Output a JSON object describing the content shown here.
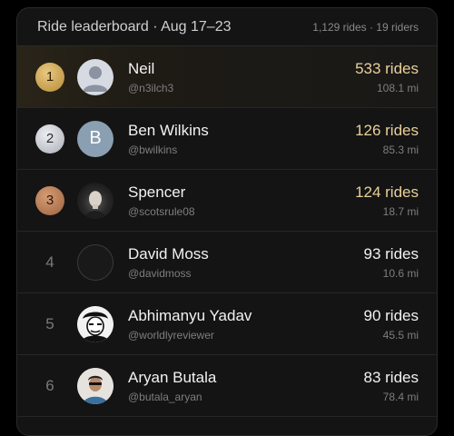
{
  "header": {
    "title": "Ride leaderboard · Aug 17–23",
    "stats": "1,129 rides · 19 riders"
  },
  "colors": {
    "gold": "#e0be72",
    "silver": "#d8dbe0",
    "bronze": "#c08560",
    "highlight_text": "#ead09a"
  },
  "riders": [
    {
      "rank": "1",
      "name": "Neil",
      "handle": "@n3ilch3",
      "rides": "533 rides",
      "miles": "108.1 mi",
      "avatar": "default-avatar-icon"
    },
    {
      "rank": "2",
      "name": "Ben Wilkins",
      "handle": "@bwilkins",
      "rides": "126 rides",
      "miles": "85.3 mi",
      "avatar_letter": "B"
    },
    {
      "rank": "3",
      "name": "Spencer",
      "handle": "@scotsrule08",
      "rides": "124 rides",
      "miles": "18.7 mi",
      "avatar": "photo"
    },
    {
      "rank": "4",
      "name": "David Moss",
      "handle": "@davidmoss",
      "rides": "93 rides",
      "miles": "10.6 mi",
      "avatar": "empty"
    },
    {
      "rank": "5",
      "name": "Abhimanyu Yadav",
      "handle": "@worldlyreviewer",
      "rides": "90 rides",
      "miles": "45.5 mi",
      "avatar": "photo"
    },
    {
      "rank": "6",
      "name": "Aryan Butala",
      "handle": "@butala_aryan",
      "rides": "83 rides",
      "miles": "78.4 mi",
      "avatar": "photo"
    }
  ]
}
